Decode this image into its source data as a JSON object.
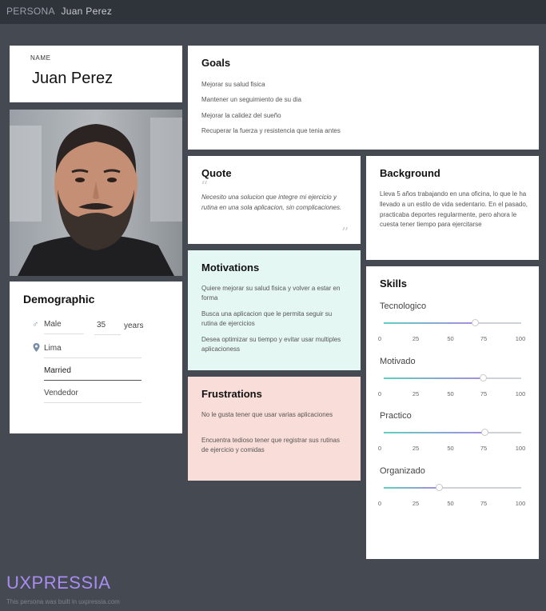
{
  "topbar": {
    "tag": "PERSONA",
    "name": "Juan Perez"
  },
  "name_card": {
    "label": "NAME",
    "name": "Juan Perez"
  },
  "demographic": {
    "title": "Demographic",
    "gender": "Male",
    "age": "35",
    "age_unit": "years",
    "location": "Lima",
    "status": "Married",
    "occupation": "Vendedor"
  },
  "goals": {
    "title": "Goals",
    "items": [
      "Mejorar su salud fisica",
      "Mantener un seguimiento de su dia",
      "Mejorar la calidez del sueño",
      "Recuperar la fuerza y resistencia que tenia antes"
    ]
  },
  "quote": {
    "title": "Quote",
    "text": "Necesito una solucion que integre mi ejercicio y rutina en una sola aplicacion, sin complicaciones."
  },
  "background": {
    "title": "Background",
    "text": "Lleva 5 años trabajando en una oficina, lo que le ha llevado a un estilo de vida sedentario. En el pasado, practicaba deportes regularmente, pero ahora le cuesta tener tiempo para ejercitarse"
  },
  "motivations": {
    "title": "Motivations",
    "items": [
      "Quiere mejorar su salud fisica y volver a estar en forma",
      "Busca una aplicacion que le permita seguir su rutina de ejercicios",
      "Desea optimizar su tiempo y evitar usar multiples aplicacioness"
    ]
  },
  "frustrations": {
    "title": "Frustrations",
    "items": [
      "No le gusta tener que usar varias aplicaciones",
      "Encuentra tedioso tener que registrar sus rutinas de ejercicio y comidas"
    ]
  },
  "skills": {
    "title": "Skills",
    "ticks": [
      "0",
      "25",
      "50",
      "75",
      "100"
    ],
    "items": [
      {
        "name": "Tecnologico",
        "value": 66
      },
      {
        "name": "Motivado",
        "value": 72
      },
      {
        "name": "Practico",
        "value": 73
      },
      {
        "name": "Organizado",
        "value": 40
      }
    ]
  },
  "footer": {
    "brand": "UXPRESSIA",
    "note": "This persona was built in uxpressia.com"
  },
  "colors": {
    "page_bg": "#454a52",
    "topbar_bg": "#2f333a",
    "motivations_bg": "#e5f7f2",
    "frustrations_bg": "#f9ddd9",
    "brand": "#a98cf2",
    "slider_start": "#5fd0c0",
    "slider_end": "#a58de0"
  }
}
